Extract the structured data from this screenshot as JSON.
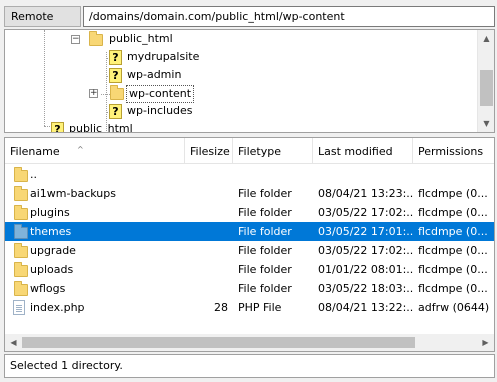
{
  "remote": {
    "label": "Remote site:",
    "path": "/domains/domain.com/public_html/wp-content"
  },
  "tree": {
    "items": [
      {
        "label": "public_html",
        "icon": "folder-icon"
      },
      {
        "label": "mydrupalsite",
        "icon": "question-icon"
      },
      {
        "label": "wp-admin",
        "icon": "question-icon"
      },
      {
        "label": "wp-content",
        "icon": "folder-icon",
        "selected": true
      },
      {
        "label": "wp-includes",
        "icon": "question-icon"
      },
      {
        "label": "public_html",
        "icon": "question-icon"
      }
    ],
    "collapse_glyph": "−",
    "expand_glyph": "+"
  },
  "columns": {
    "filename": "Filename",
    "filesize": "Filesize",
    "filetype": "Filetype",
    "last_modified": "Last modified",
    "permissions": "Permissions"
  },
  "files": [
    {
      "name": "..",
      "size": "",
      "type": "",
      "modified": "",
      "perms": "",
      "icon": "folder-icon"
    },
    {
      "name": "ai1wm-backups",
      "size": "",
      "type": "File folder",
      "modified": "08/04/21 13:23:...",
      "perms": "flcdmpe (0...",
      "icon": "folder-icon"
    },
    {
      "name": "plugins",
      "size": "",
      "type": "File folder",
      "modified": "03/05/22 17:02:...",
      "perms": "flcdmpe (0...",
      "icon": "folder-icon"
    },
    {
      "name": "themes",
      "size": "",
      "type": "File folder",
      "modified": "03/05/22 17:01:...",
      "perms": "flcdmpe (0...",
      "icon": "folder-icon",
      "selected": true
    },
    {
      "name": "upgrade",
      "size": "",
      "type": "File folder",
      "modified": "03/05/22 17:02:...",
      "perms": "flcdmpe (0...",
      "icon": "folder-icon"
    },
    {
      "name": "uploads",
      "size": "",
      "type": "File folder",
      "modified": "01/01/22 08:01:...",
      "perms": "flcdmpe (0...",
      "icon": "folder-icon"
    },
    {
      "name": "wflogs",
      "size": "",
      "type": "File folder",
      "modified": "03/05/22 18:03:...",
      "perms": "flcdmpe (0...",
      "icon": "folder-icon"
    },
    {
      "name": "index.php",
      "size": "28",
      "type": "PHP File",
      "modified": "08/04/21 13:22:...",
      "perms": "adfrw (0644)",
      "icon": "file-icon"
    }
  ],
  "status": {
    "text": "Selected 1 directory."
  },
  "colors": {
    "selection": "#0078d7",
    "folder": "#f8d775"
  }
}
